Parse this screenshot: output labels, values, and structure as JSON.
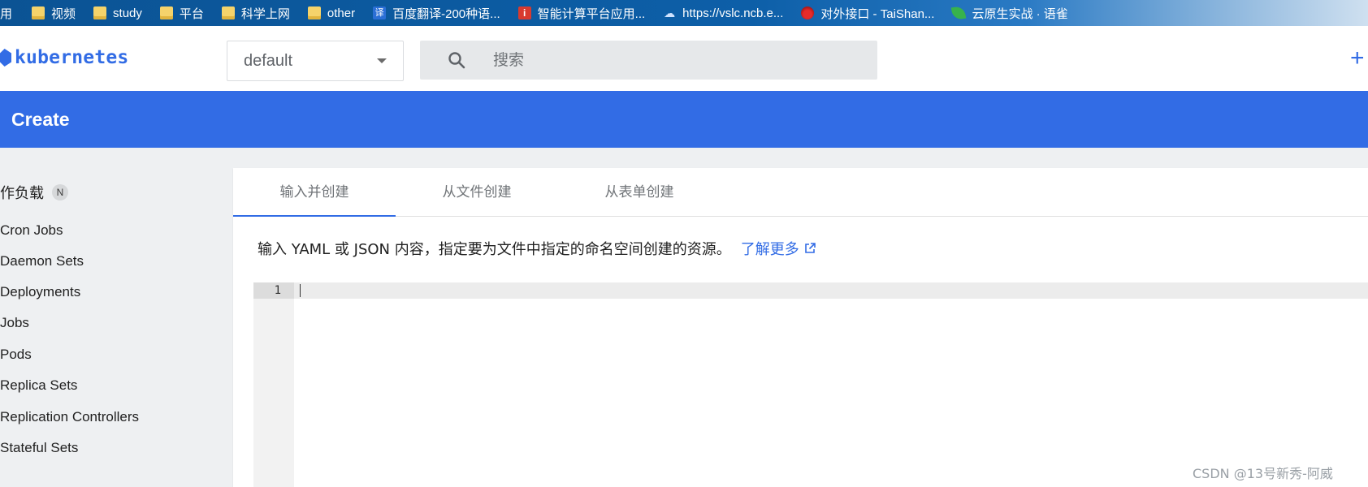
{
  "bookmarks_bar": {
    "items": [
      {
        "label": "用",
        "icon": "none"
      },
      {
        "label": "视频",
        "icon": "folder-icon"
      },
      {
        "label": "study",
        "icon": "folder-icon"
      },
      {
        "label": "平台",
        "icon": "folder-icon"
      },
      {
        "label": "科学上网",
        "icon": "folder-icon"
      },
      {
        "label": "other",
        "icon": "folder-icon"
      },
      {
        "label": "百度翻译-200种语...",
        "icon": "translate-icon"
      },
      {
        "label": "智能计算平台应用...",
        "icon": "info-icon"
      },
      {
        "label": "https://vslc.ncb.e...",
        "icon": "cloud-icon"
      },
      {
        "label": "对外接口 - TaiShan...",
        "icon": "huawei-icon"
      },
      {
        "label": "云原生实战 · 语雀",
        "icon": "leaf-icon"
      }
    ]
  },
  "header": {
    "logo_text": "kubernetes",
    "namespace": {
      "value": "default"
    },
    "search": {
      "placeholder": "搜索"
    },
    "plus_label": "+"
  },
  "toolbar": {
    "title": "Create"
  },
  "sidebar": {
    "heading": "作负载",
    "badge": "N",
    "items": [
      "Cron Jobs",
      "Daemon Sets",
      "Deployments",
      "Jobs",
      "Pods",
      "Replica Sets",
      "Replication Controllers",
      "Stateful Sets"
    ]
  },
  "main": {
    "tabs": [
      {
        "label": "输入并创建",
        "active": true
      },
      {
        "label": "从文件创建",
        "active": false
      },
      {
        "label": "从表单创建",
        "active": false
      }
    ],
    "description": "输入 YAML 或 JSON 内容，指定要为文件中指定的命名空间创建的资源。",
    "learn_more": "了解更多",
    "editor": {
      "line_number": "1",
      "content": ""
    }
  },
  "watermark": "CSDN @13号新秀-阿威",
  "colors": {
    "accent": "#326ce5",
    "background": "#eef0f2",
    "card": "#ffffff"
  }
}
